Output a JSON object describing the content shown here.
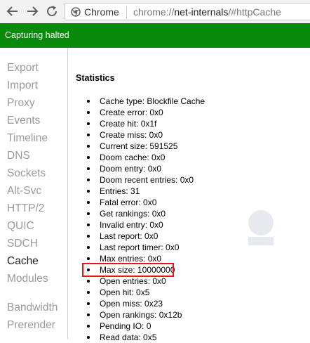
{
  "browser": {
    "product_chip": "Chrome",
    "url_scheme": "chrome://",
    "url_host": "net-internals",
    "url_path": "/#httpCache"
  },
  "status": {
    "text": "Capturing halted",
    "color": "#0a8a0a"
  },
  "sidebar": {
    "items": [
      {
        "label": "Export"
      },
      {
        "label": "Import"
      },
      {
        "label": "Proxy"
      },
      {
        "label": "Events"
      },
      {
        "label": "Timeline"
      },
      {
        "label": "DNS"
      },
      {
        "label": "Sockets"
      },
      {
        "label": "Alt-Svc"
      },
      {
        "label": "HTTP/2"
      },
      {
        "label": "QUIC"
      },
      {
        "label": "SDCH"
      },
      {
        "label": "Cache"
      },
      {
        "label": "Modules"
      },
      {
        "label": "Bandwidth"
      },
      {
        "label": "Prerender"
      }
    ],
    "active": "Cache"
  },
  "main": {
    "heading": "Statistics",
    "stats": [
      "Cache type: Blockfile Cache",
      "Create error: 0x0",
      "Create hit: 0x1f",
      "Create miss: 0x0",
      "Current size: 591525",
      "Doom cache: 0x0",
      "Doom entry: 0x0",
      "Doom recent entries: 0x0",
      "Entries: 31",
      "Fatal error: 0x0",
      "Get rankings: 0x0",
      "Invalid entry: 0x0",
      "Last report: 0x0",
      "Last report timer: 0x0",
      "Max entries: 0x0",
      "Max size: 10000000",
      "Open entries: 0x0",
      "Open hit: 0x5",
      "Open miss: 0x23",
      "Open rankings: 0x12b",
      "Pending IO: 0",
      "Read data: 0x5"
    ],
    "highlighted": "Max size: 10000000",
    "highlight_color": "#e01818"
  }
}
